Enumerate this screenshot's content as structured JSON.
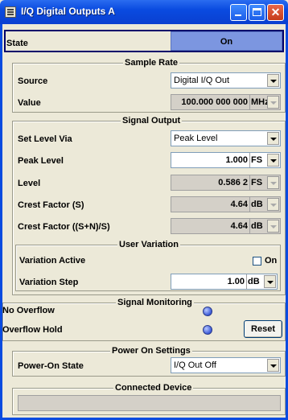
{
  "window": {
    "title": "I/Q Digital Outputs A"
  },
  "state": {
    "label": "State",
    "value": "On"
  },
  "sample_rate": {
    "title": "Sample Rate",
    "source_label": "Source",
    "source_value": "Digital I/Q Out",
    "value_label": "Value",
    "value": "100.000 000 000",
    "unit": "MHz"
  },
  "signal_output": {
    "title": "Signal Output",
    "set_level_via_label": "Set Level Via",
    "set_level_via_value": "Peak Level",
    "peak_level_label": "Peak Level",
    "peak_level_value": "1.000",
    "peak_level_unit": "FS",
    "level_label": "Level",
    "level_value": "0.586 2",
    "level_unit": "FS",
    "crest_factor_s_label": "Crest Factor (S)",
    "crest_factor_s_value": "4.64",
    "crest_factor_s_unit": "dB",
    "crest_factor_sn_label": "Crest Factor ((S+N)/S)",
    "crest_factor_sn_value": "4.64",
    "crest_factor_sn_unit": "dB"
  },
  "user_variation": {
    "title": "User Variation",
    "variation_active_label": "Variation Active",
    "variation_active_checkbox_label": "On",
    "variation_active_checked": false,
    "variation_step_label": "Variation Step",
    "variation_step_value": "1.00",
    "variation_step_unit": "dB"
  },
  "signal_monitoring": {
    "title": "Signal Monitoring",
    "no_overflow_label": "No Overflow",
    "overflow_hold_label": "Overflow Hold",
    "reset_label": "Reset",
    "led_color": "#3a5ad8"
  },
  "power_on_settings": {
    "title": "Power On Settings",
    "power_on_state_label": "Power-On State",
    "power_on_state_value": "I/Q Out Off"
  },
  "connected_device": {
    "title": "Connected Device",
    "value": ""
  },
  "colors": {
    "titlebar": "#0a4be0",
    "state_button": "#7c96e0",
    "background": "#ece9d8"
  }
}
